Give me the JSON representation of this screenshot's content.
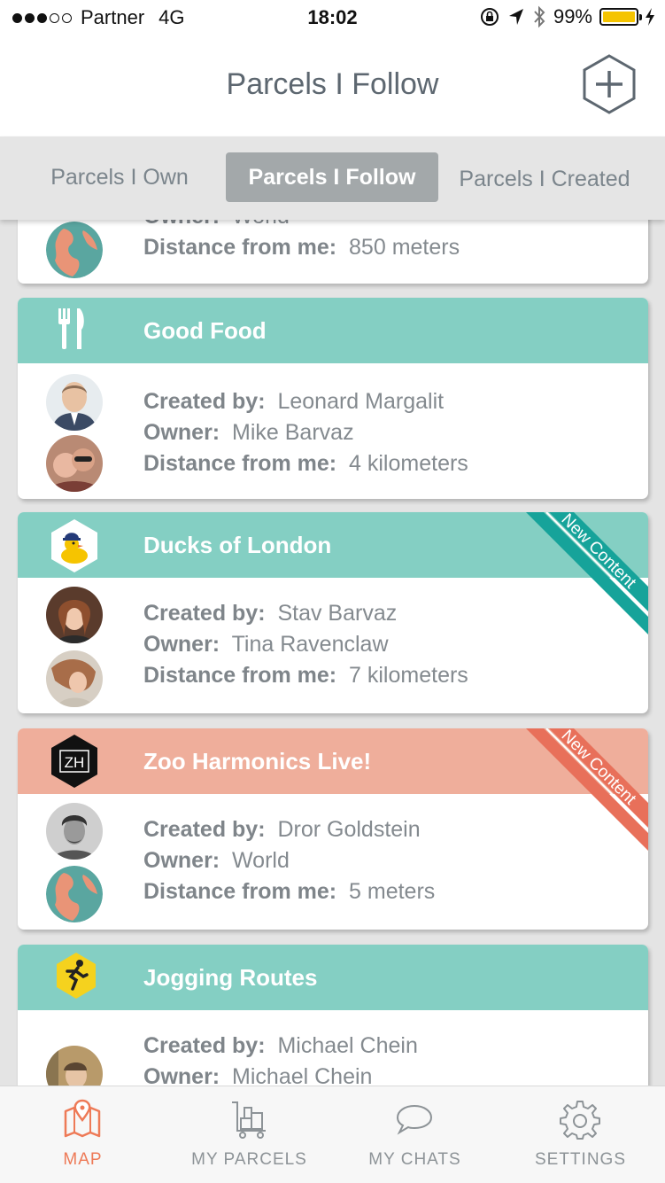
{
  "status_bar": {
    "carrier": "Partner",
    "network": "4G",
    "time": "18:02",
    "battery": "99%",
    "signal_bars": 3
  },
  "header": {
    "title": "Parcels I Follow",
    "add_icon": "plus-hexagon-icon"
  },
  "tabs": [
    {
      "label": "Parcels I Own",
      "active": false
    },
    {
      "label": "Parcels I Follow",
      "active": true
    },
    {
      "label": "Parcels I Created",
      "active": false
    }
  ],
  "labels": {
    "created_by": "Created by:",
    "owner": "Owner:",
    "distance": "Distance from me:"
  },
  "cards": [
    {
      "title": "",
      "owner": "World",
      "distance": "850 meters"
    },
    {
      "title": "Good Food",
      "icon": "fork-knife-icon",
      "color": "#84cfc3",
      "created_by": "Leonard Margalit",
      "owner": "Mike Barvaz",
      "distance": "4 kilometers"
    },
    {
      "title": "Ducks of London",
      "icon": "duck-icon",
      "color": "#84cfc3",
      "ribbon": "New Content",
      "created_by": "Stav Barvaz",
      "owner": "Tina Ravenclaw",
      "distance": "7 kilometers"
    },
    {
      "title": "Zoo Harmonics Live!",
      "icon": "zh-logo-icon",
      "icon_text": "ZH",
      "color": "#efae9b",
      "ribbon": "New Content",
      "created_by": "Dror Goldstein",
      "owner": "World",
      "distance": "5 meters"
    },
    {
      "title": "Jogging Routes",
      "icon": "runner-icon",
      "color": "#84cfc3",
      "created_by": "Michael Chein",
      "owner": "Michael Chein"
    }
  ],
  "bottom_nav": [
    {
      "label": "MAP",
      "icon": "map-pin-icon",
      "active": true
    },
    {
      "label": "MY PARCELS",
      "icon": "parcels-cart-icon",
      "active": false
    },
    {
      "label": "MY CHATS",
      "icon": "chat-bubble-icon",
      "active": false
    },
    {
      "label": "SETTINGS",
      "icon": "gear-icon",
      "active": false
    }
  ],
  "colors": {
    "teal": "#84cfc3",
    "salmon": "#efae9b",
    "accent": "#ee7a57",
    "ribbon_teal": "#16a39a",
    "ribbon_salmon": "#e8705a"
  }
}
